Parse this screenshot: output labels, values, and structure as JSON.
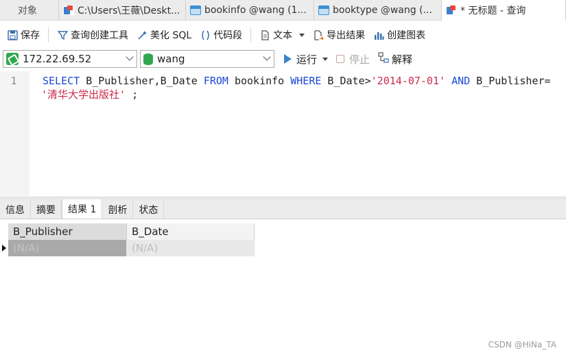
{
  "tabs": [
    {
      "label": "对象",
      "icon": ""
    },
    {
      "label": "C:\\Users\\王薇\\Deskt...",
      "icon": "query-icon"
    },
    {
      "label": "bookinfo @wang (1...",
      "icon": "table-icon"
    },
    {
      "label": "booktype @wang (...",
      "icon": "table-icon"
    },
    {
      "label": "* 无标题 - 查询",
      "icon": "query-icon"
    }
  ],
  "toolbar": {
    "save": "保存",
    "query_builder": "查询创建工具",
    "beautify": "美化 SQL",
    "snippet": "代码段",
    "text": "文本",
    "export": "导出结果",
    "create_chart": "创建图表"
  },
  "connection": {
    "server": "172.22.69.52",
    "database": "wang",
    "run": "运行",
    "stop": "停止",
    "explain": "解释"
  },
  "editor": {
    "line_number": "1",
    "tokens_line1": [
      {
        "t": "SELECT",
        "c": "kw"
      },
      {
        "t": " B_Publisher,B_Date ",
        "c": "plain"
      },
      {
        "t": "FROM",
        "c": "kw"
      },
      {
        "t": " bookinfo ",
        "c": "plain"
      },
      {
        "t": "WHERE",
        "c": "kw"
      },
      {
        "t": " B_Date>",
        "c": "plain"
      },
      {
        "t": "'2014-07-01'",
        "c": "str"
      },
      {
        "t": " ",
        "c": "plain"
      },
      {
        "t": "AND",
        "c": "kw"
      },
      {
        "t": " B_Publisher=",
        "c": "plain"
      }
    ],
    "tokens_line2": [
      {
        "t": "'清华大学出版社'",
        "c": "str"
      },
      {
        "t": " ;",
        "c": "plain"
      }
    ]
  },
  "result_tabs": [
    "信息",
    "摘要",
    "结果 1",
    "剖析",
    "状态"
  ],
  "result_active_index": 2,
  "grid": {
    "columns": [
      "B_Publisher",
      "B_Date"
    ],
    "rows": [
      [
        "(N/A)",
        "(N/A)"
      ]
    ]
  },
  "watermark": "CSDN @HiNa_TA"
}
